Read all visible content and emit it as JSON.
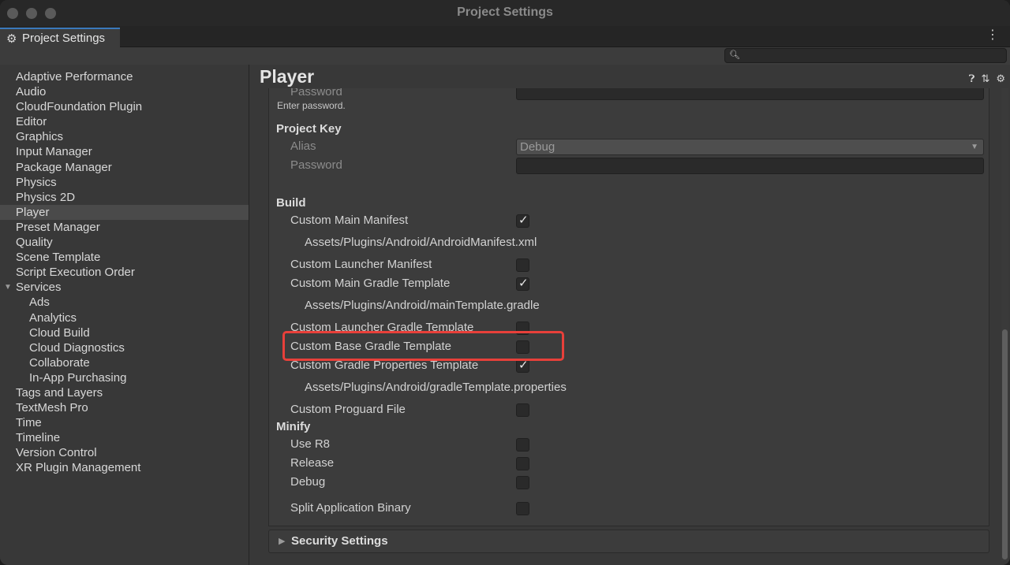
{
  "window": {
    "title": "Project Settings"
  },
  "tab": {
    "label": "Project Settings",
    "icon": "gear-icon",
    "menu_icon": "kebab-menu-icon"
  },
  "search": {
    "placeholder": "",
    "value": ""
  },
  "sidebar": {
    "items": [
      {
        "label": "Adaptive Performance"
      },
      {
        "label": "Audio"
      },
      {
        "label": "CloudFoundation Plugin"
      },
      {
        "label": "Editor"
      },
      {
        "label": "Graphics"
      },
      {
        "label": "Input Manager"
      },
      {
        "label": "Package Manager"
      },
      {
        "label": "Physics"
      },
      {
        "label": "Physics 2D"
      },
      {
        "label": "Player",
        "selected": true
      },
      {
        "label": "Preset Manager"
      },
      {
        "label": "Quality"
      },
      {
        "label": "Scene Template"
      },
      {
        "label": "Script Execution Order"
      },
      {
        "label": "Services",
        "expanded": true
      },
      {
        "label": "Ads",
        "child": true
      },
      {
        "label": "Analytics",
        "child": true
      },
      {
        "label": "Cloud Build",
        "child": true
      },
      {
        "label": "Cloud Diagnostics",
        "child": true
      },
      {
        "label": "Collaborate",
        "child": true
      },
      {
        "label": "In-App Purchasing",
        "child": true
      },
      {
        "label": "Tags and Layers"
      },
      {
        "label": "TextMesh Pro"
      },
      {
        "label": "Time"
      },
      {
        "label": "Timeline"
      },
      {
        "label": "Version Control"
      },
      {
        "label": "XR Plugin Management"
      }
    ]
  },
  "main": {
    "title": "Player",
    "header_icons": [
      "help-icon",
      "presets-icon",
      "settings-icon"
    ],
    "keystore": {
      "password_label": "Password",
      "password_hint": "Enter password."
    },
    "project_key": {
      "header": "Project Key",
      "alias_label": "Alias",
      "alias_value": "Debug",
      "password_label": "Password"
    },
    "build": {
      "header": "Build",
      "custom_main_manifest": {
        "label": "Custom Main Manifest",
        "checked": true,
        "path": "Assets/Plugins/Android/AndroidManifest.xml"
      },
      "custom_launcher_manifest": {
        "label": "Custom Launcher Manifest",
        "checked": false
      },
      "custom_main_gradle": {
        "label": "Custom Main Gradle Template",
        "checked": true,
        "path": "Assets/Plugins/Android/mainTemplate.gradle"
      },
      "custom_launcher_gradle": {
        "label": "Custom Launcher Gradle Template",
        "checked": false
      },
      "custom_base_gradle": {
        "label": "Custom Base Gradle Template",
        "checked": false
      },
      "custom_gradle_properties": {
        "label": "Custom Gradle Properties Template",
        "checked": true,
        "path": "Assets/Plugins/Android/gradleTemplate.properties"
      },
      "custom_proguard": {
        "label": "Custom Proguard File",
        "checked": false
      }
    },
    "minify": {
      "header": "Minify",
      "use_r8": {
        "label": "Use R8",
        "checked": false
      },
      "release": {
        "label": "Release",
        "checked": false
      },
      "debug": {
        "label": "Debug",
        "checked": false
      }
    },
    "split_binary": {
      "label": "Split Application Binary",
      "checked": false
    },
    "security": {
      "label": "Security Settings"
    }
  },
  "colors": {
    "accent": "#3a79bb",
    "highlight": "#e8403a",
    "background": "#383838"
  }
}
